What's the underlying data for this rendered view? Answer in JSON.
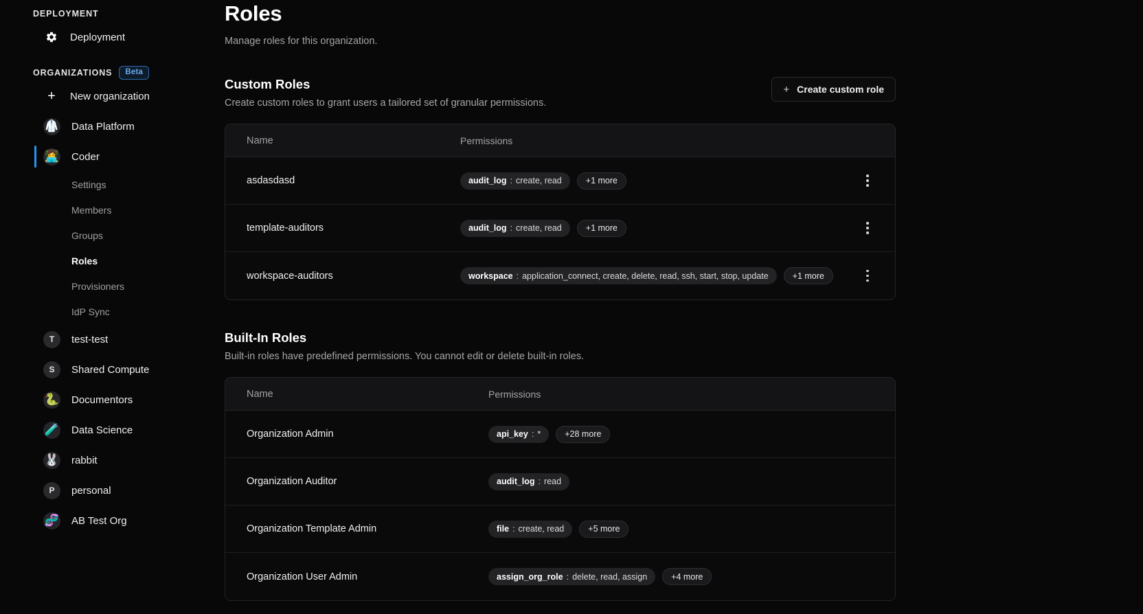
{
  "sidebar": {
    "deployment_label": "DEPLOYMENT",
    "deployment_item": {
      "label": "Deployment",
      "icon": "gear-icon"
    },
    "organizations_label": "ORGANIZATIONS",
    "beta_badge": "Beta",
    "new_organization": {
      "label": "New organization",
      "icon": "plus-icon"
    },
    "orgs": [
      {
        "label": "Data Platform",
        "avatar": "🥼",
        "type": "emoji"
      },
      {
        "label": "Coder",
        "avatar": "👩‍💻",
        "type": "emoji",
        "active": true
      }
    ],
    "sub_items": [
      {
        "label": "Settings",
        "current": false
      },
      {
        "label": "Members",
        "current": false
      },
      {
        "label": "Groups",
        "current": false
      },
      {
        "label": "Roles",
        "current": true
      },
      {
        "label": "Provisioners",
        "current": false
      },
      {
        "label": "IdP Sync",
        "current": false
      }
    ],
    "more_orgs": [
      {
        "label": "test-test",
        "avatar": "T",
        "type": "letter"
      },
      {
        "label": "Shared Compute",
        "avatar": "S",
        "type": "letter"
      },
      {
        "label": "Documentors",
        "avatar": "🐍",
        "type": "emoji"
      },
      {
        "label": "Data Science",
        "avatar": "🧪",
        "type": "emoji"
      },
      {
        "label": "rabbit",
        "avatar": "🐰",
        "type": "emoji"
      },
      {
        "label": "personal",
        "avatar": "P",
        "type": "letter"
      },
      {
        "label": "AB Test Org",
        "avatar": "🧬",
        "type": "emoji"
      }
    ]
  },
  "page": {
    "title": "Roles",
    "subtitle": "Manage roles for this organization."
  },
  "custom_roles": {
    "title": "Custom Roles",
    "description": "Create custom roles to grant users a tailored set of granular permissions.",
    "create_button": "Create custom role",
    "create_button_icon": "plus-icon",
    "columns": {
      "name": "Name",
      "permissions": "Permissions"
    },
    "rows": [
      {
        "name": "asdasdasd",
        "permissions": [
          {
            "resource": "audit_log",
            "separator": ":",
            "actions": "create, read"
          }
        ],
        "more": "+1 more"
      },
      {
        "name": "template-auditors",
        "permissions": [
          {
            "resource": "audit_log",
            "separator": ":",
            "actions": "create, read"
          }
        ],
        "more": "+1 more"
      },
      {
        "name": "workspace-auditors",
        "permissions": [
          {
            "resource": "workspace",
            "separator": ":",
            "actions": "application_connect, create, delete, read, ssh, start, stop, update"
          }
        ],
        "more": "+1 more"
      }
    ]
  },
  "builtin_roles": {
    "title": "Built-In Roles",
    "description": "Built-in roles have predefined permissions. You cannot edit or delete built-in roles.",
    "columns": {
      "name": "Name",
      "permissions": "Permissions"
    },
    "rows": [
      {
        "name": "Organization Admin",
        "permissions": [
          {
            "resource": "api_key",
            "separator": ":",
            "actions": "*"
          }
        ],
        "more": "+28 more"
      },
      {
        "name": "Organization Auditor",
        "permissions": [
          {
            "resource": "audit_log",
            "separator": ":",
            "actions": "read"
          }
        ],
        "more": ""
      },
      {
        "name": "Organization Template Admin",
        "permissions": [
          {
            "resource": "file",
            "separator": ":",
            "actions": "create, read"
          }
        ],
        "more": "+5 more"
      },
      {
        "name": "Organization User Admin",
        "permissions": [
          {
            "resource": "assign_org_role",
            "separator": ":",
            "actions": "delete, read, assign"
          }
        ],
        "more": "+4 more"
      }
    ]
  },
  "colors": {
    "accent": "#2196f3",
    "background": "#080808",
    "card": "#0a0a0b",
    "header_row": "#141416",
    "border": "#242427",
    "pill": "#232326",
    "muted_text": "#a6a6aa"
  }
}
